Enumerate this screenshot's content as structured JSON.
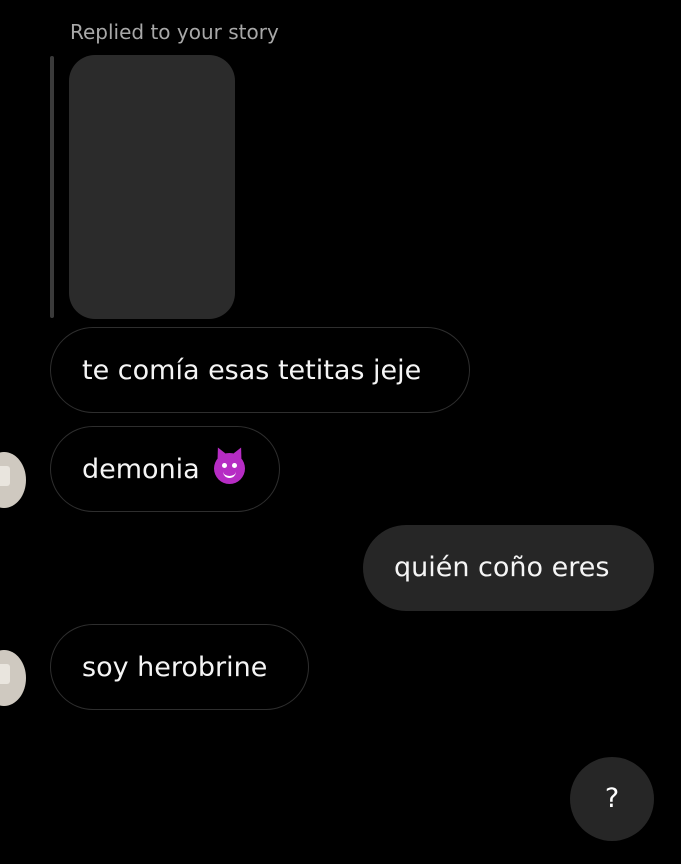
{
  "reply": {
    "label": "Replied to your story"
  },
  "messages": [
    {
      "text": "te comía esas tetitas jeje",
      "direction": "incoming"
    },
    {
      "text": "demonia",
      "emoji": "smiling-devil-emoji",
      "direction": "incoming"
    },
    {
      "text": "quién coño eres",
      "direction": "outgoing"
    },
    {
      "text": "soy herobrine",
      "direction": "incoming"
    }
  ],
  "help_button": {
    "label": "?"
  },
  "colors": {
    "background": "#000000",
    "incoming_border": "#2e2e2e",
    "outgoing_bubble": "#262626",
    "secondary_text": "#a8a8a8",
    "emoji": "#b62cc4"
  }
}
